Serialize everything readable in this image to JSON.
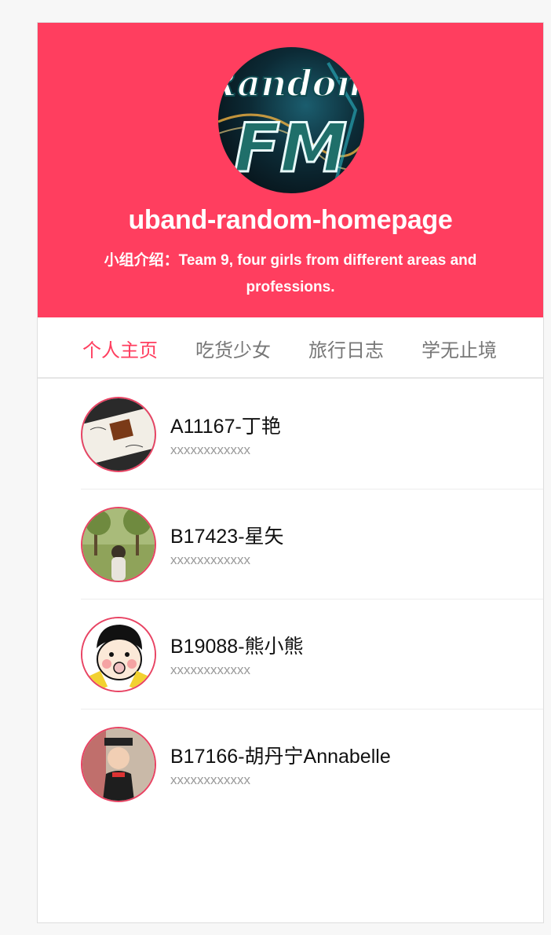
{
  "header": {
    "title": "uband-random-homepage",
    "intro": "小组介绍：Team 9, four girls from different areas and professions.",
    "logo_text_top": "Random",
    "logo_text_bottom": "FM",
    "background_color": "#ff3e5f"
  },
  "tabs": [
    {
      "label": "个人主页",
      "active": true
    },
    {
      "label": "吃货少女",
      "active": false
    },
    {
      "label": "旅行日志",
      "active": false
    },
    {
      "label": "学无止境",
      "active": false
    }
  ],
  "members": [
    {
      "name": "A11167-丁艳",
      "subtitle": "xxxxxxxxxxxx"
    },
    {
      "name": "B17423-星矢",
      "subtitle": "xxxxxxxxxxxx"
    },
    {
      "name": "B19088-熊小熊",
      "subtitle": "xxxxxxxxxxxx"
    },
    {
      "name": "B17166-胡丹宁Annabelle",
      "subtitle": "xxxxxxxxxxxx"
    }
  ],
  "colors": {
    "accent": "#ff3e5f",
    "tab_inactive": "#777777",
    "avatar_border": "#e84363"
  }
}
